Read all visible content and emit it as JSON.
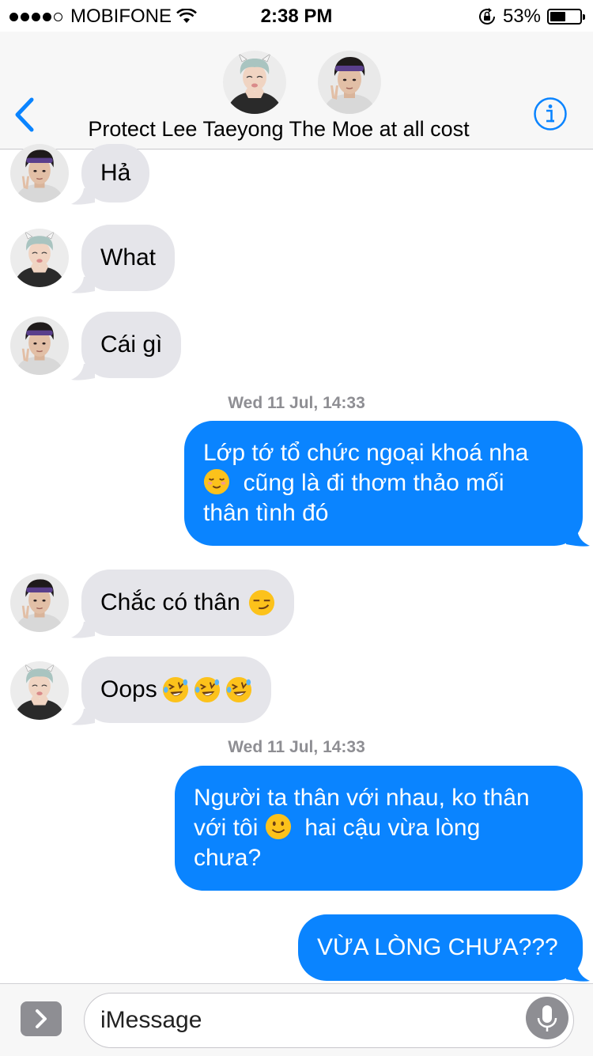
{
  "status_bar": {
    "carrier": "MOBIFONE",
    "time": "2:38 PM",
    "battery": "53%",
    "battery_level": 0.53,
    "signal_bars_filled": 4,
    "signal_bars_total": 5
  },
  "header": {
    "title": "Protect Lee Taeyong The Moe at all cost",
    "back_icon": "chevron-left-icon",
    "info_icon": "info-icon",
    "accent_color": "#0a84ff"
  },
  "messages": [
    {
      "sender": "purple-headband",
      "text": "Hả"
    },
    {
      "sender": "grey-hair",
      "text": "What"
    },
    {
      "sender": "purple-headband",
      "text": "Cái gì"
    }
  ],
  "timestamp1": {
    "day": "Wed 11 Jul,",
    "time": "14:33"
  },
  "outgoing1": {
    "line1": "Lớp tớ tổ chức ngoại khoá nha",
    "line2": "cũng là đi thơm thảo mối",
    "line3": "thân tình đó",
    "emoji": "relieved-face-icon"
  },
  "messages2": [
    {
      "sender": "purple-headband",
      "text": "Chắc có thân",
      "emoji": "smirking-face-icon"
    },
    {
      "sender": "grey-hair",
      "text": "Oops",
      "emoji": "rolling-on-floor-laughing-icon"
    }
  ],
  "timestamp2": {
    "day": "Wed 11 Jul,",
    "time": "14:33"
  },
  "outgoing2": {
    "line1": "Người ta thân với nhau, ko thân",
    "line2a": "với tôi",
    "line2b": "hai cậu vừa lòng",
    "line3": "chưa?",
    "emoji": "slightly-smiling-face-icon"
  },
  "outgoing3": {
    "text": "VỪA LÒNG CHƯA???"
  },
  "input_bar": {
    "placeholder": "iMessage",
    "expand_icon": "chevron-right-icon",
    "mic_icon": "microphone-icon"
  },
  "colors": {
    "incoming_bubble": "#e5e5ea",
    "outgoing_bubble": "#0a84ff",
    "timestamp": "#8e8e93"
  }
}
